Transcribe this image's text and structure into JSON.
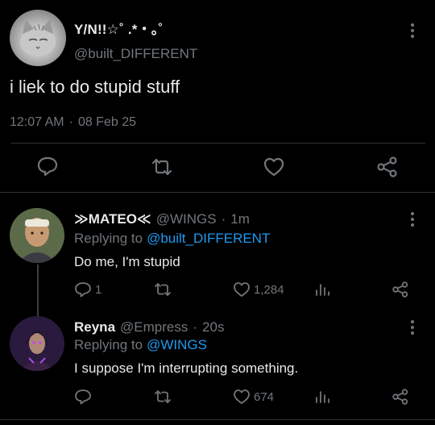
{
  "main_tweet": {
    "display_name": "Y/N!!☆˚ .*・｡˚",
    "handle": "@built_DIFFERENT",
    "text": "i liek to do stupid stuff",
    "time": "12:07 AM",
    "date": "08 Feb 25",
    "actions": [
      "reply-icon",
      "retweet-icon",
      "like-icon",
      "share-icon"
    ]
  },
  "replies": [
    {
      "display_name": "≫MATEO≪",
      "handle": "@WINGS",
      "age": "1m",
      "replying_label": "Replying to",
      "replying_to": "@built_DIFFERENT",
      "text": "Do me, I'm stupid",
      "reply_count": "1",
      "like_count": "1,284"
    },
    {
      "display_name": "Reyna",
      "handle": "@Empress",
      "age": "20s",
      "replying_label": "Replying to",
      "replying_to": "@WINGS",
      "text": "I suppose I'm interrupting something.",
      "like_count": "674"
    }
  ],
  "separator": "·",
  "colors": {
    "background": "#000000",
    "text": "#e7e9ea",
    "muted": "#71767b",
    "link": "#1d9bf0",
    "divider": "#2f3336"
  }
}
